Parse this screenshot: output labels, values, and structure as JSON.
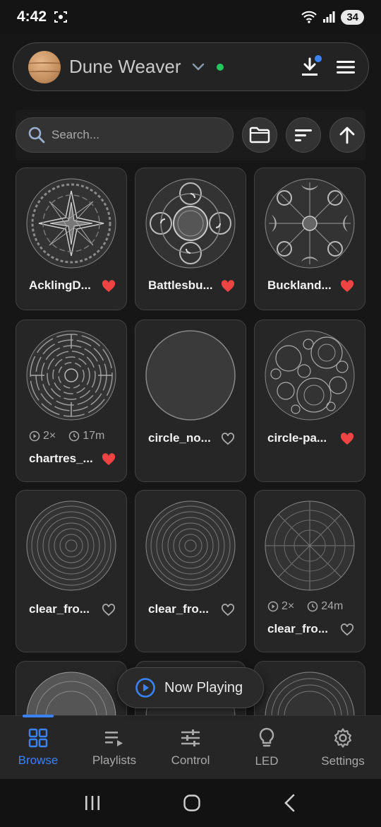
{
  "status_bar": {
    "time": "4:42",
    "battery": "34"
  },
  "header": {
    "app_name": "Dune Weaver",
    "connection_status_color": "#22c55e"
  },
  "search": {
    "placeholder": "Search..."
  },
  "patterns": [
    {
      "name": "AcklingD...",
      "favorite": true
    },
    {
      "name": "Battlesbu...",
      "favorite": true
    },
    {
      "name": "Buckland...",
      "favorite": true
    },
    {
      "name": "chartres_...",
      "favorite": true,
      "plays": "2×",
      "duration": "17m"
    },
    {
      "name": "circle_no...",
      "favorite": false
    },
    {
      "name": "circle-pa...",
      "favorite": true
    },
    {
      "name": "clear_fro...",
      "favorite": false
    },
    {
      "name": "clear_fro...",
      "favorite": false
    },
    {
      "name": "clear_fro...",
      "favorite": false,
      "plays": "2×",
      "duration": "24m"
    }
  ],
  "now_playing": {
    "label": "Now Playing"
  },
  "nav": [
    {
      "label": "Browse",
      "icon": "grid-icon",
      "active": true
    },
    {
      "label": "Playlists",
      "icon": "playlist-icon",
      "active": false
    },
    {
      "label": "Control",
      "icon": "sliders-icon",
      "active": false
    },
    {
      "label": "LED",
      "icon": "bulb-icon",
      "active": false
    },
    {
      "label": "Settings",
      "icon": "gear-icon",
      "active": false
    }
  ],
  "colors": {
    "accent": "#3b82f6",
    "favorite": "#ef4444",
    "online": "#22c55e"
  }
}
